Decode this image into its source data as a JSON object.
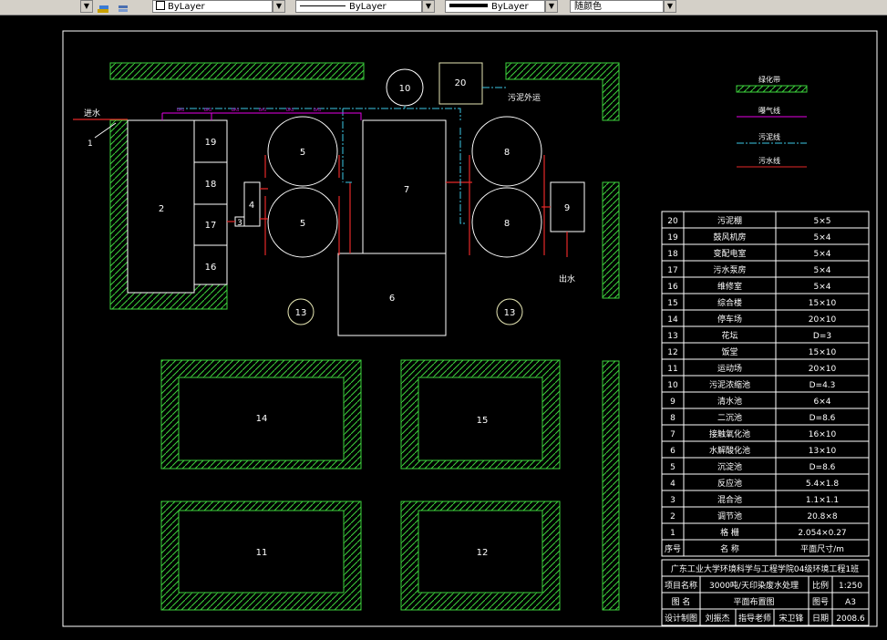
{
  "toolbar": {
    "layer_color": "ByLayer",
    "linetype": "ByLayer",
    "lineweight": "ByLayer",
    "plot_style": "随颜色"
  },
  "colors": {
    "background": "#000000",
    "frame": "#ffffff",
    "structure": "#ffffff",
    "green_belt": "#3cd23c",
    "sludge_building": "#e6e6b4",
    "aeration": "#e600e6",
    "sludge_line": "#3cc8e6",
    "sewage_line": "#e62828"
  },
  "labels": {
    "inlet": "进水",
    "inlet_num": "1",
    "outlet": "出水",
    "sludge_out": "污泥外运",
    "pipe_tag": "DA1"
  },
  "units": [
    {
      "id": "u2",
      "label": "2"
    },
    {
      "id": "u3",
      "label": "3"
    },
    {
      "id": "u4",
      "label": "4"
    },
    {
      "id": "u5a",
      "label": "5"
    },
    {
      "id": "u5b",
      "label": "5"
    },
    {
      "id": "u6",
      "label": "6"
    },
    {
      "id": "u7",
      "label": "7"
    },
    {
      "id": "u8a",
      "label": "8"
    },
    {
      "id": "u8b",
      "label": "8"
    },
    {
      "id": "u9",
      "label": "9"
    },
    {
      "id": "u10",
      "label": "10"
    },
    {
      "id": "u11",
      "label": "11"
    },
    {
      "id": "u12",
      "label": "12"
    },
    {
      "id": "u13a",
      "label": "13"
    },
    {
      "id": "u13b",
      "label": "13"
    },
    {
      "id": "u14",
      "label": "14"
    },
    {
      "id": "u15",
      "label": "15"
    },
    {
      "id": "u16",
      "label": "16"
    },
    {
      "id": "u17",
      "label": "17"
    },
    {
      "id": "u18",
      "label": "18"
    },
    {
      "id": "u19",
      "label": "19"
    },
    {
      "id": "u20",
      "label": "20"
    }
  ],
  "legend": [
    {
      "label": "绿化带",
      "kind": "green"
    },
    {
      "label": "曝气线",
      "kind": "aeration"
    },
    {
      "label": "污泥线",
      "kind": "sludge"
    },
    {
      "label": "污水线",
      "kind": "sewage"
    }
  ],
  "schedule": {
    "rows": [
      {
        "no": "20",
        "name": "污泥棚",
        "size": "5×5"
      },
      {
        "no": "19",
        "name": "鼓风机房",
        "size": "5×4"
      },
      {
        "no": "18",
        "name": "变配电室",
        "size": "5×4"
      },
      {
        "no": "17",
        "name": "污水泵房",
        "size": "5×4"
      },
      {
        "no": "16",
        "name": "维修室",
        "size": "5×4"
      },
      {
        "no": "15",
        "name": "综合楼",
        "size": "15×10"
      },
      {
        "no": "14",
        "name": "停车场",
        "size": "20×10"
      },
      {
        "no": "13",
        "name": "花坛",
        "size": "D=3"
      },
      {
        "no": "12",
        "name": "饭堂",
        "size": "15×10"
      },
      {
        "no": "11",
        "name": "运动场",
        "size": "20×10"
      },
      {
        "no": "10",
        "name": "污泥浓缩池",
        "size": "D=4.3"
      },
      {
        "no": "9",
        "name": "清水池",
        "size": "6×4"
      },
      {
        "no": "8",
        "name": "二沉池",
        "size": "D=8.6"
      },
      {
        "no": "7",
        "name": "接触氧化池",
        "size": "16×10"
      },
      {
        "no": "6",
        "name": "水解酸化池",
        "size": "13×10"
      },
      {
        "no": "5",
        "name": "沉淀池",
        "size": "D=8.6"
      },
      {
        "no": "4",
        "name": "反应池",
        "size": "5.4×1.8"
      },
      {
        "no": "3",
        "name": "混合池",
        "size": "1.1×1.1"
      },
      {
        "no": "2",
        "name": "调节池",
        "size": "20.8×8"
      },
      {
        "no": "1",
        "name": "格 栅",
        "size": "2.054×0.27"
      }
    ],
    "header": {
      "no": "序号",
      "name": "名 称",
      "size": "平面尺寸/m"
    }
  },
  "title_block": {
    "school": "广东工业大学环境科学与工程学院04级环境工程1班",
    "project_label": "项目名称",
    "project": "3000吨/天印染废水处理",
    "scale_label": "比例",
    "scale": "1:250",
    "drawing_label": "图  名",
    "drawing": "平面布置图",
    "number_label": "图号",
    "number": "A3",
    "designer_label": "设计制图",
    "designer": "刘振杰",
    "advisor_label": "指导老师",
    "advisor": "宋卫锋",
    "date_label": "日期",
    "date": "2008.6"
  }
}
